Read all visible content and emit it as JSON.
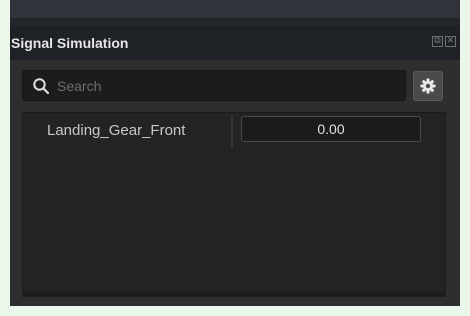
{
  "panel": {
    "title": "Signal Simulation",
    "window_icons": [
      "restore-icon",
      "close-icon"
    ]
  },
  "search": {
    "placeholder": "Search",
    "value": ""
  },
  "settings_button": {
    "icon": "gear-icon"
  },
  "signals": [
    {
      "name": "Landing_Gear_Front",
      "value": "0.00"
    }
  ],
  "colors": {
    "panel_bg": "#2e2e2e",
    "title_bg": "#1e2125",
    "list_bg": "#232323",
    "field_bg": "#1b1b1b",
    "text": "#e6e6e6"
  }
}
